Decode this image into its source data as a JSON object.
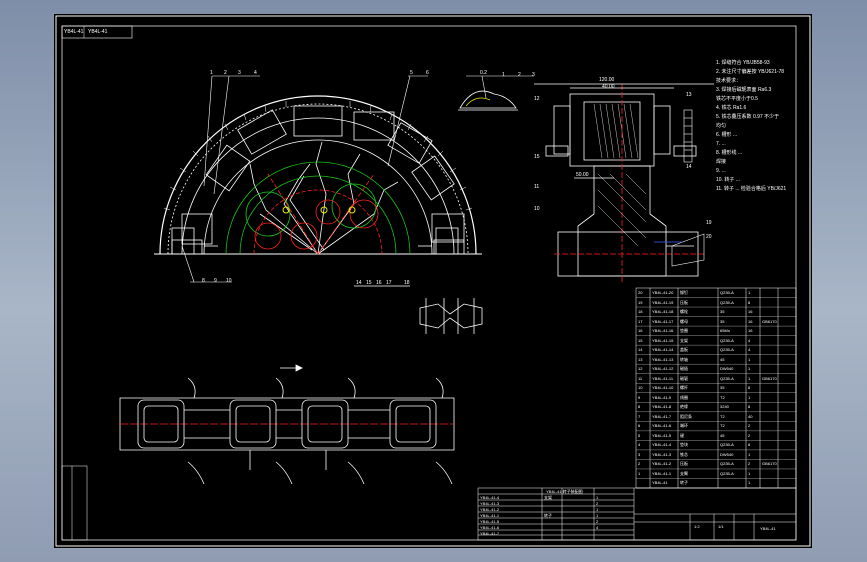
{
  "title_block": {
    "top_left_code": "YB4L-41",
    "scale": "1:2",
    "sheet": "1/1",
    "drawing_no": "YB4L-41"
  },
  "callouts": {
    "top_left": [
      "1",
      "2",
      "3",
      "4"
    ],
    "top_mid": [
      "5",
      "6"
    ],
    "bottom": [
      "8",
      "9",
      "10"
    ],
    "clip": [
      "1",
      "2",
      "3"
    ],
    "center_mark": "0.2",
    "small_bottom": [
      "14",
      "15",
      "16",
      "17",
      "18"
    ],
    "right_side": [
      "12",
      "13",
      "14",
      "15"
    ],
    "right_lower": [
      "11",
      "10",
      "19",
      "20"
    ]
  },
  "dimensions": {
    "top_width": "120.00",
    "inner_width": "40.00",
    "shaft_width": "50.00"
  },
  "notes": [
    "1. 焊缝符合 YB/JB58-93",
    "2. 未注尺寸偏差按 YB/J621-78",
    "   技术要求：",
    "3. 焊接后磁轭表面 Ra6.3",
    "   铁芯不平度小于0.5",
    "4. 铁芯 Ra1.6",
    "5. 铁芯叠压系数 0.97 不少于",
    "   均匀",
    "6. 槽形 ...",
    "7. ...",
    "8. 槽形线 ...",
    "   焊接",
    "9. ...",
    "10. 转子 ...",
    "11. 转子 ... 检验合格后 YB/J621"
  ],
  "parts_rows": [
    [
      "20",
      "YB4L-41-20",
      "铆钉",
      "Q235-A",
      "1",
      ""
    ],
    [
      "19",
      "YB4L-41-19",
      "压板",
      "Q235-A",
      "8",
      ""
    ],
    [
      "18",
      "YB4L-41-18",
      "螺栓",
      "35",
      "16",
      ""
    ],
    [
      "17",
      "YB4L-41-17",
      "螺母",
      "35",
      "16",
      "GB6170"
    ],
    [
      "16",
      "YB4L-41-16",
      "垫圈",
      "65Mn",
      "16",
      ""
    ],
    [
      "15",
      "YB4L-41-15",
      "支架",
      "Q235-A",
      "4",
      ""
    ],
    [
      "14",
      "YB4L-41-14",
      "盖板",
      "Q235-A",
      "4",
      ""
    ],
    [
      "13",
      "YB4L-41-13",
      "转轴",
      "45",
      "1",
      ""
    ],
    [
      "12",
      "YB4L-41-12",
      "磁极",
      "DW540",
      "1",
      ""
    ],
    [
      "11",
      "YB4L-41-11",
      "磁轭",
      "Q235-A",
      "1",
      "GB6170"
    ],
    [
      "10",
      "YB4L-41-10",
      "螺杆",
      "35",
      "8",
      ""
    ],
    [
      "9",
      "YB4L-41-9",
      "线圈",
      "T2",
      "1",
      ""
    ],
    [
      "8",
      "YB4L-41-8",
      "绝缘",
      "3240",
      "8",
      ""
    ],
    [
      "7",
      "YB4L-41-7",
      "阻尼条",
      "T2",
      "40",
      ""
    ],
    [
      "6",
      "YB4L-41-6",
      "端环",
      "T2",
      "2",
      ""
    ],
    [
      "5",
      "YB4L-41-5",
      "键",
      "45",
      "2",
      ""
    ],
    [
      "4",
      "YB4L-41-4",
      "垫块",
      "Q235-A",
      "8",
      ""
    ],
    [
      "3",
      "YB4L-41-3",
      "铁芯",
      "DW540",
      "1",
      ""
    ],
    [
      "2",
      "YB4L-41-2",
      "压板",
      "Q235-A",
      "2",
      "GB6170"
    ],
    [
      "1",
      "YB4L-41-1",
      "支臂",
      "Q235-A",
      "1",
      ""
    ],
    [
      "",
      "YB4L-41",
      "转子",
      "",
      "1",
      ""
    ]
  ],
  "bottom_table": {
    "header": "YB4L-41 转子装配图",
    "rows": [
      [
        "YB4L-41-4",
        "支架",
        "",
        "1"
      ],
      [
        "YB4L-41-3",
        "",
        "",
        "2"
      ],
      [
        "YB4L-41-2",
        "",
        "",
        "1"
      ],
      [
        "YB4L-41-1",
        "转子",
        "",
        "1"
      ],
      [
        "YB4L-41-5",
        "",
        "",
        "2"
      ],
      [
        "YB4L-41-6",
        "",
        "",
        "4"
      ],
      [
        "YB4L-41-7",
        "",
        "",
        ""
      ]
    ]
  },
  "colors": {
    "line": "#ffffff",
    "red": "#ff2020",
    "green": "#18c018",
    "yellow": "#e8e800",
    "blue": "#4060ff"
  }
}
